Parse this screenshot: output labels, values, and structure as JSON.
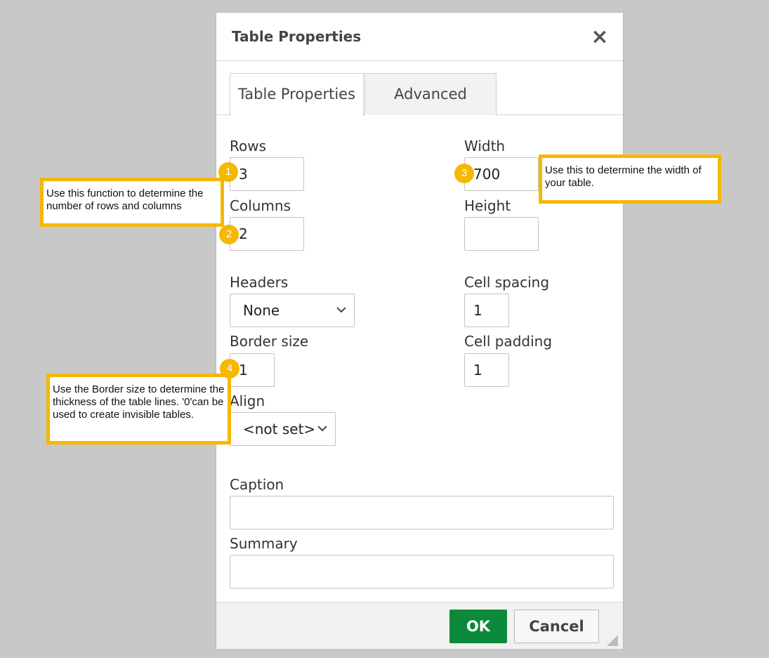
{
  "dialog": {
    "title": "Table Properties",
    "close_glyph": "×",
    "tabs": [
      {
        "label": "Table Properties",
        "active": true
      },
      {
        "label": "Advanced",
        "active": false
      }
    ],
    "fields": {
      "rows": {
        "label": "Rows",
        "value": "3"
      },
      "columns": {
        "label": "Columns",
        "value": "2"
      },
      "headers": {
        "label": "Headers",
        "selected": "None"
      },
      "border_size": {
        "label": "Border size",
        "value": "1"
      },
      "align": {
        "label": "Align",
        "selected": "<not set>"
      },
      "width": {
        "label": "Width",
        "value": "700"
      },
      "height": {
        "label": "Height",
        "value": ""
      },
      "cell_spacing": {
        "label": "Cell spacing",
        "value": "1"
      },
      "cell_padding": {
        "label": "Cell padding",
        "value": "1"
      },
      "caption": {
        "label": "Caption",
        "value": ""
      },
      "summary": {
        "label": "Summary",
        "value": ""
      }
    },
    "buttons": {
      "ok": "OK",
      "cancel": "Cancel"
    }
  },
  "annotations": [
    {
      "number": "1",
      "text": "Use this function to determine the number of rows and columns"
    },
    {
      "number": "2",
      "text": ""
    },
    {
      "number": "3",
      "text": "Use this to determine the width of your table."
    },
    {
      "number": "4",
      "text": "Use the Border size to determine the thickness of the table lines. '0'can be used to create invisible tables."
    }
  ],
  "colors": {
    "ok_button": "#0b8a3c",
    "callout_accent": "#f5b800",
    "backdrop": "#c8c8c8"
  },
  "icons": {
    "close": "close-icon",
    "select_arrow": "chevron-down-icon",
    "resize": "resize-grip-icon"
  }
}
